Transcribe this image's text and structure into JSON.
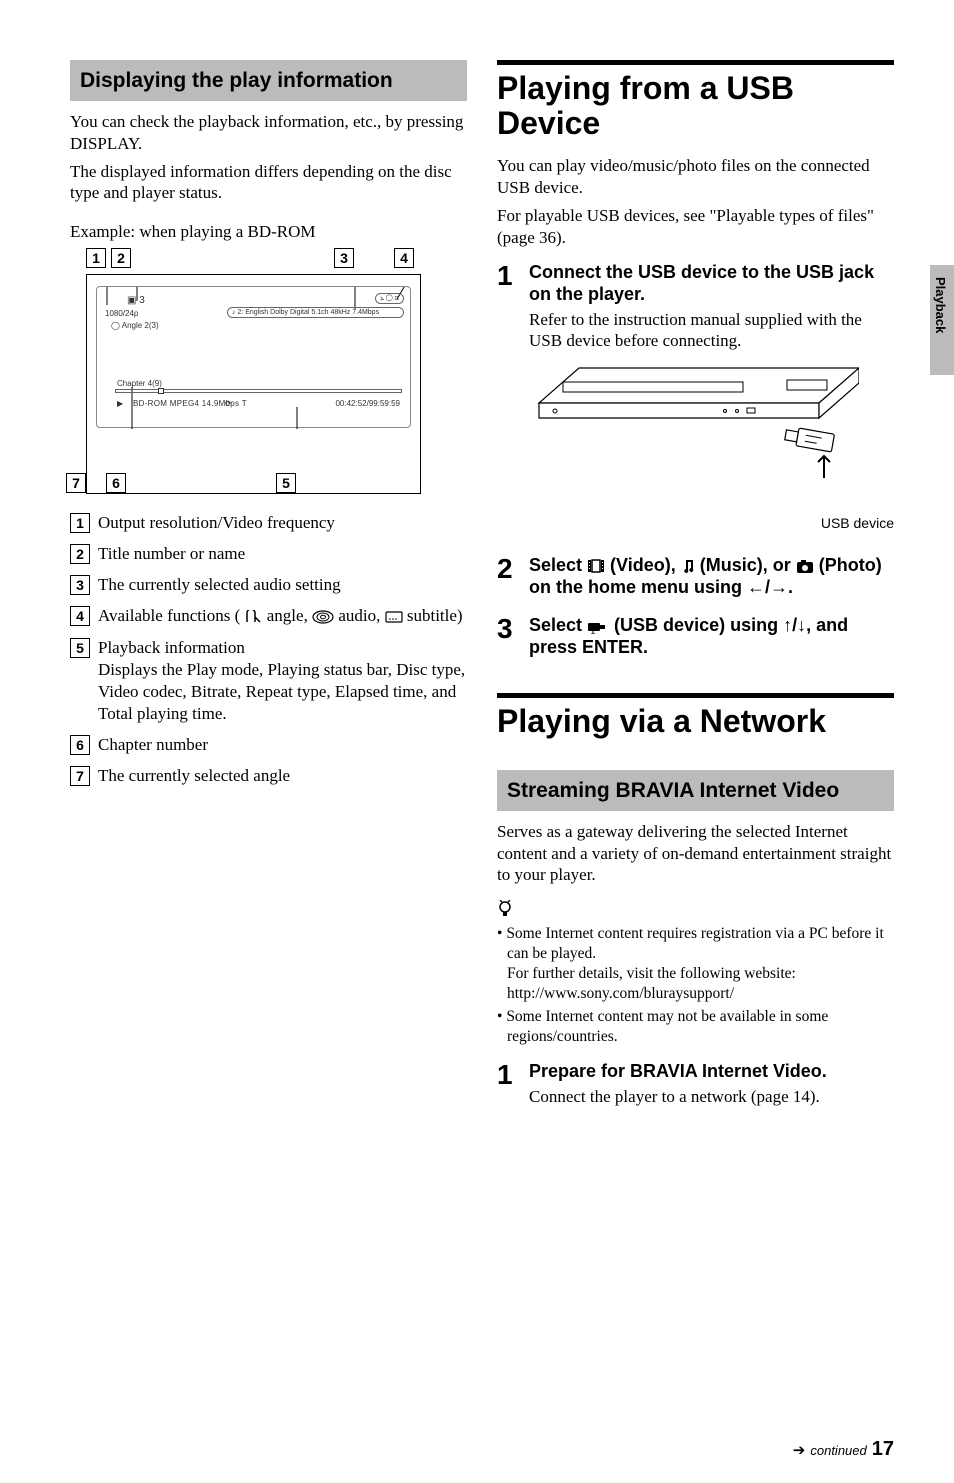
{
  "sideTab": "Playback",
  "leftCol": {
    "sectionTitle": "Displaying the play information",
    "para1": "You can check the playback information, etc., by pressing DISPLAY.",
    "para2": "The displayed information differs depending on the disc type and player status.",
    "example": "Example: when playing a BD-ROM",
    "display": {
      "titleIcon": "3",
      "res": "1080/24p",
      "angle": "Angle  2(3)",
      "chapter": "Chapter 4(9)",
      "audioLine": "2: English Dolby Digital 5.1ch 48kHz  7.4Mbps",
      "bottomLine": "BD-ROM  MPEG4  14.9Mbps        T",
      "time": "00:42:52/99:59:59"
    },
    "items": [
      {
        "num": "1",
        "text": "Output resolution/Video frequency"
      },
      {
        "num": "2",
        "text": "Title number or name"
      },
      {
        "num": "3",
        "text": "The currently selected audio setting"
      },
      {
        "num": "4",
        "text": "Available functions (        angle,         audio,        subtitle)"
      },
      {
        "num": "5",
        "text": "Playback information",
        "sub": "Displays the Play mode, Playing status bar, Disc type, Video codec, Bitrate, Repeat type, Elapsed time, and Total playing time."
      },
      {
        "num": "6",
        "text": "Chapter number"
      },
      {
        "num": "7",
        "text": "The currently selected angle"
      }
    ]
  },
  "rightCol": {
    "h1a": "Playing from a USB Device",
    "para_a1": "You can play video/music/photo files on the connected USB device.",
    "para_a2": "For playable USB devices, see \"Playable types of files\" (page 36).",
    "stepsA": [
      {
        "num": "1",
        "title": "Connect the USB device to the USB jack on the player.",
        "desc": "Refer to the instruction manual supplied with the USB device before connecting."
      },
      {
        "num": "2",
        "title": "Select      (Video),      (Music), or      (Photo) on the home menu using ←/→."
      },
      {
        "num": "3",
        "title": "Select        (USB device) using ↑/↓, and press ENTER."
      }
    ],
    "usbCaption": "USB device",
    "h1b": "Playing via a Network",
    "sectionTitleB": "Streaming BRAVIA Internet Video",
    "para_b1": "Serves as a gateway delivering the selected Internet content and a variety of on-demand entertainment straight to your player.",
    "tips": [
      {
        "line": "Some Internet content requires registration via a PC before it can be played.",
        "sub1": "For further details, visit the following website:",
        "sub2": "http://www.sony.com/bluraysupport/"
      },
      {
        "line": "Some Internet content may not be available in some regions/countries."
      }
    ],
    "stepsB": [
      {
        "num": "1",
        "title": "Prepare for BRAVIA Internet Video.",
        "desc": "Connect the player to a network (page 14)."
      }
    ]
  },
  "footer": {
    "continued": "continued",
    "page": "17"
  }
}
